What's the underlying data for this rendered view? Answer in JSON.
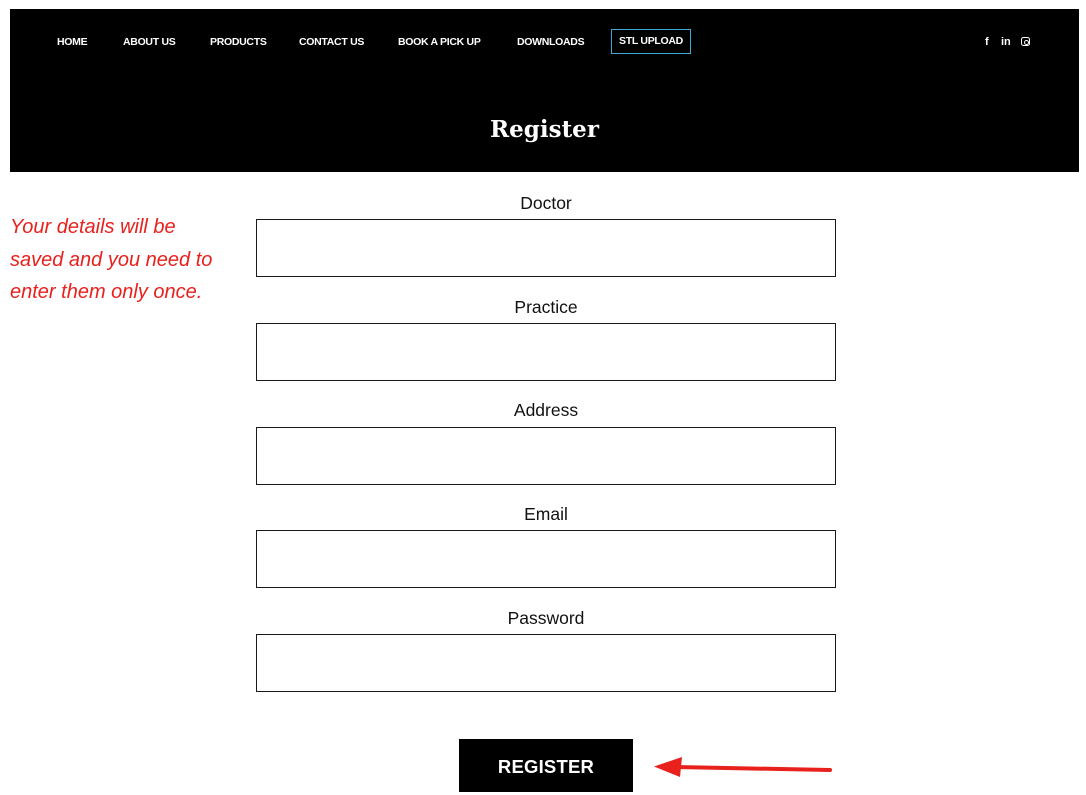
{
  "nav": {
    "items": [
      "HOME",
      "ABOUT US",
      "PRODUCTS",
      "CONTACT US",
      "BOOK A PICK UP",
      "DOWNLOADS"
    ],
    "highlighted": "STL UPLOAD",
    "social": [
      "facebook-icon",
      "linkedin-icon",
      "instagram-icon"
    ],
    "facebook_glyph": "f",
    "linkedin_glyph": "in",
    "highlight_color": "#3fa9d6"
  },
  "header": {
    "title": "Register"
  },
  "note": {
    "text": "Your details will be saved and you need to enter them only once.",
    "color": "#e8211d"
  },
  "form": {
    "fields": [
      {
        "label": "Doctor",
        "value": ""
      },
      {
        "label": "Practice",
        "value": ""
      },
      {
        "label": "Address",
        "value": ""
      },
      {
        "label": "Email",
        "value": ""
      },
      {
        "label": "Password",
        "value": ""
      }
    ],
    "submit_label": "REGISTER"
  },
  "annotation": {
    "arrow_color": "#e8211d"
  }
}
